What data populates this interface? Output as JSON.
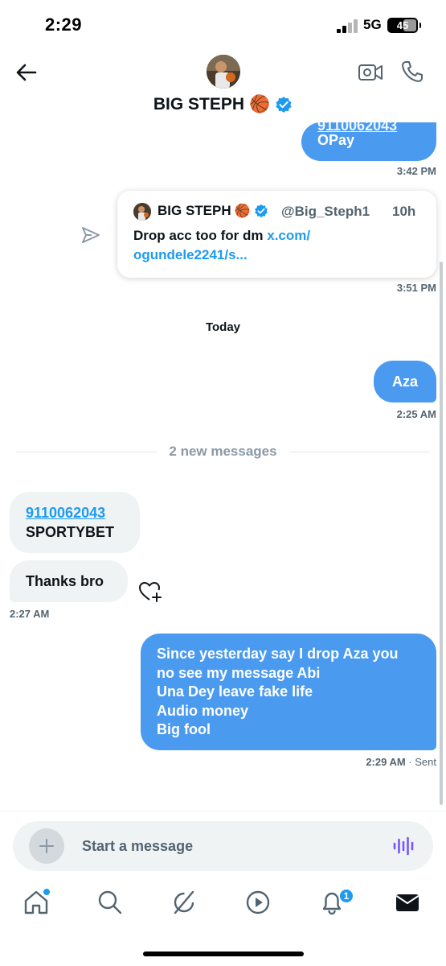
{
  "status_bar": {
    "time": "2:29",
    "network": "5G",
    "battery": "45"
  },
  "header": {
    "name": "BIG STEPH",
    "emoji": "🏀",
    "icons": [
      "back-arrow-icon",
      "video-call-icon",
      "phone-icon",
      "verified-badge-icon"
    ]
  },
  "messages": {
    "opay": {
      "text": "OPay",
      "time": "3:42 PM"
    },
    "shared_post": {
      "author": "BIG STEPH",
      "handle": "@Big_Steph1",
      "age": "10h",
      "text": "Drop acc too for dm ",
      "link_line1": "x.com/",
      "link_line2": "ogundele2241/s...",
      "time": "3:51 PM"
    },
    "day_separator": "Today",
    "aza": {
      "text": "Aza",
      "time": "2:25 AM"
    },
    "new_messages": "2 new messages",
    "sportybet": {
      "number": "9110062043",
      "label": "SPORTYBET"
    },
    "thanks": {
      "text": "Thanks bro",
      "time": "2:27 AM"
    },
    "long": {
      "lines": [
        "Since yesterday say I drop Aza you",
        "no see my message Abi",
        "Una Dey leave fake life",
        "Audio money",
        "Big fool"
      ],
      "time": "2:29 AM",
      "status": "· Sent"
    }
  },
  "composer": {
    "placeholder": "Start a message"
  },
  "tab_bar": {
    "items": [
      "home-icon",
      "search-icon",
      "grok-icon",
      "video-icon",
      "notifications-icon",
      "messages-icon"
    ],
    "notification_count": "1"
  },
  "colors": {
    "bubble_out": "#4a9af0",
    "bubble_in": "#eff3f4",
    "link": "#1d9bf0",
    "verified": "#1d9bf0"
  }
}
